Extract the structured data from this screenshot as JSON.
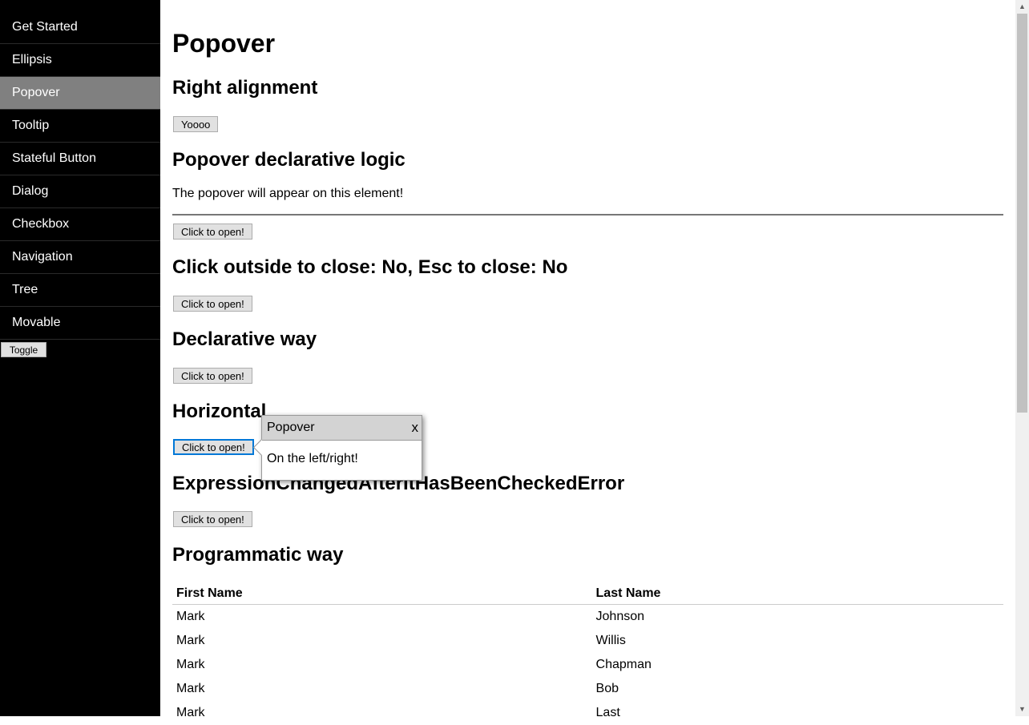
{
  "sidebar": {
    "items": [
      {
        "label": "Get Started"
      },
      {
        "label": "Ellipsis"
      },
      {
        "label": "Popover",
        "active": true
      },
      {
        "label": "Tooltip"
      },
      {
        "label": "Stateful Button"
      },
      {
        "label": "Dialog"
      },
      {
        "label": "Checkbox"
      },
      {
        "label": "Navigation"
      },
      {
        "label": "Tree"
      },
      {
        "label": "Movable"
      }
    ],
    "toggle_label": "Toggle"
  },
  "main": {
    "title": "Popover",
    "sections": {
      "right_alignment": {
        "heading": "Right alignment",
        "button": "Yoooo"
      },
      "declarative_logic": {
        "heading": "Popover declarative logic",
        "text": "The popover will appear on this element!",
        "button": "Click to open!"
      },
      "click_outside": {
        "heading": "Click outside to close: No, Esc to close: No",
        "button": "Click to open!"
      },
      "declarative_way": {
        "heading": "Declarative way",
        "button": "Click to open!"
      },
      "horizontal": {
        "heading": "Horizontal",
        "button": "Click to open!"
      },
      "expression": {
        "heading": "ExpressionChangedAfterItHasBeenCheckedError",
        "button": "Click to open!"
      },
      "programmatic": {
        "heading": "Programmatic way"
      }
    },
    "table": {
      "headers": [
        "First Name",
        "Last Name"
      ],
      "rows": [
        [
          "Mark",
          "Johnson"
        ],
        [
          "Mark",
          "Willis"
        ],
        [
          "Mark",
          "Chapman"
        ],
        [
          "Mark",
          "Bob"
        ],
        [
          "Mark",
          "Last"
        ]
      ]
    }
  },
  "popover": {
    "title": "Popover",
    "close": "x",
    "body": "On the left/right!"
  },
  "colors": {
    "sidebar_bg": "#000000",
    "active_item": "#808080",
    "popover_header": "#d3d3d3",
    "focus": "#0078d7"
  }
}
